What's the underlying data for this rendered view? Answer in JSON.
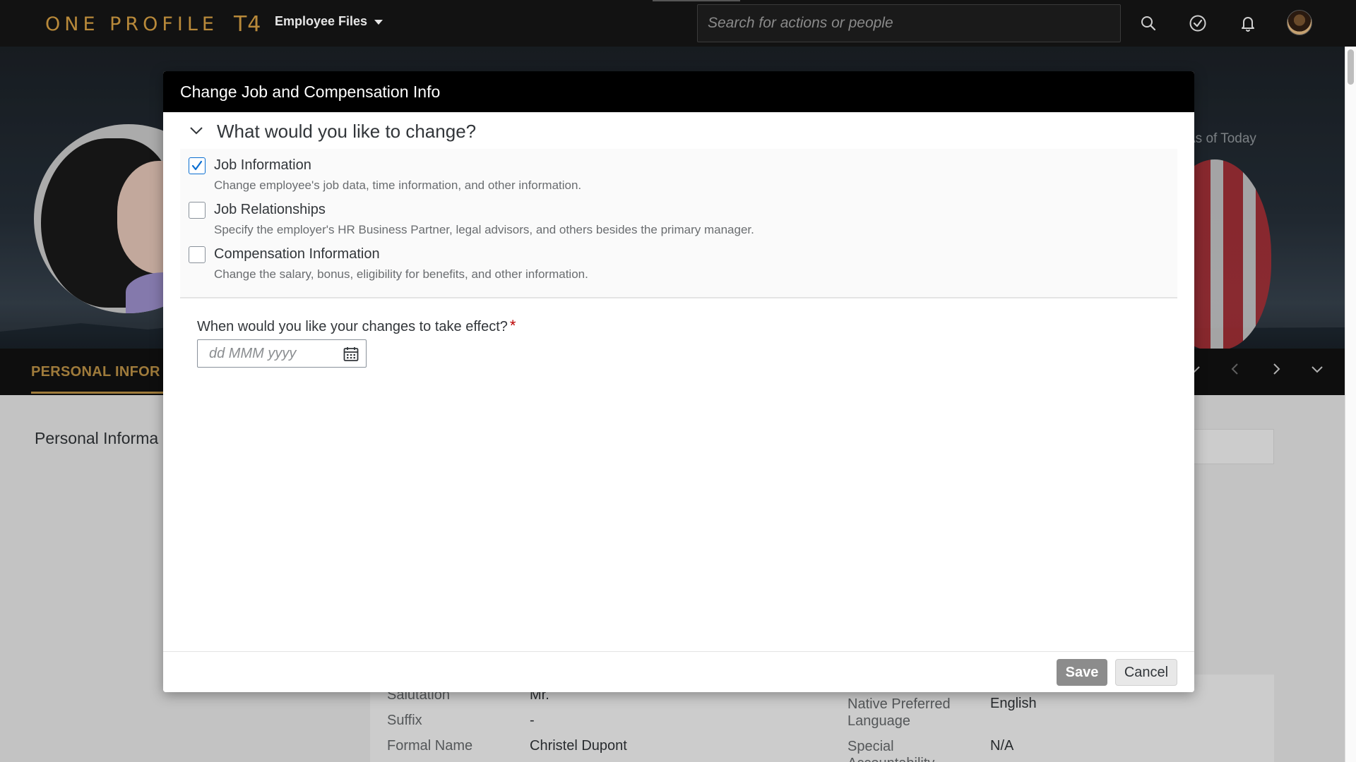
{
  "shell": {
    "logo_text": "ONE PROFILE",
    "logo_suffix": "T4",
    "menu_label": "Employee Files",
    "search_placeholder": "Search for actions or people",
    "icons": [
      "search-icon",
      "checkmark-circle-icon",
      "bell-icon",
      "user-avatar"
    ]
  },
  "background": {
    "as_of_label": "As of Today",
    "tab_label": "PERSONAL INFOR",
    "section_title": "Personal Informa",
    "fields_left": [
      {
        "label": "Salutation",
        "value": "Mr."
      },
      {
        "label": "Suffix",
        "value": "-"
      },
      {
        "label": "Formal Name",
        "value": "Christel Dupont"
      }
    ],
    "fields_right": [
      {
        "label": "Native Preferred Language",
        "value": "English"
      },
      {
        "label": "Special Accountability",
        "value": "N/A"
      }
    ]
  },
  "dialog": {
    "title": "Change Job and Compensation Info",
    "section_title": "What would you like to change?",
    "options": [
      {
        "label": "Job Information",
        "description": "Change employee's job data, time information, and other information.",
        "checked": true
      },
      {
        "label": "Job Relationships",
        "description": "Specify the employer's HR Business Partner, legal advisors, and others besides the primary manager.",
        "checked": false
      },
      {
        "label": "Compensation Information",
        "description": "Change the salary, bonus, eligibility for benefits, and other information.",
        "checked": false
      }
    ],
    "effective_label": "When would you like your changes to take effect?",
    "required_marker": "*",
    "date_placeholder": "dd MMM yyyy",
    "save_label": "Save",
    "cancel_label": "Cancel"
  },
  "colors": {
    "brand_gold": "#b8893a",
    "accent_blue": "#0a6ed1",
    "required_red": "#bb0000",
    "shell_bg": "#121212"
  }
}
